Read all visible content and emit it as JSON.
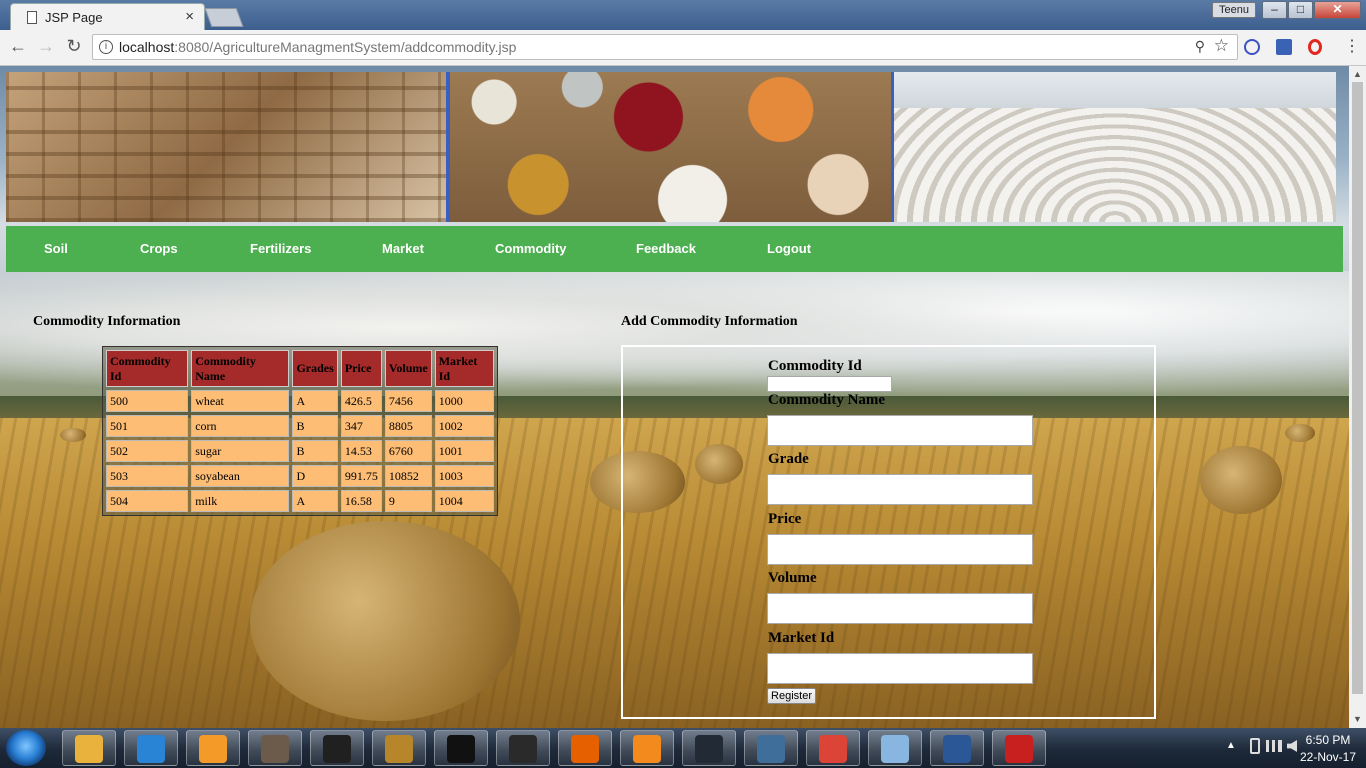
{
  "browser": {
    "tab_title": "JSP Page",
    "tab_close": "×",
    "user_badge": "Teenu",
    "win_min": "–",
    "win_max": "□",
    "win_close": "✕",
    "url_host": "localhost",
    "url_rest": ":8080/AgricultureManagmentSystem/addcommodity.jsp",
    "back": "←",
    "forward": "→",
    "reload": "↻",
    "info": "i",
    "zoom": "⚲",
    "star": "☆",
    "menu": "⋮"
  },
  "nav": {
    "items": [
      "Soil",
      "Crops",
      "Fertilizers",
      "Market",
      "Commodity",
      "Feedback",
      "Logout"
    ]
  },
  "list": {
    "title": "Commodity Information",
    "headers": [
      "Commodity Id",
      "Commodity Name",
      "Grades",
      "Price",
      "Volume",
      "Market Id"
    ],
    "rows": [
      [
        "500",
        "wheat",
        "A",
        "426.5",
        "7456",
        "1000"
      ],
      [
        "501",
        "corn",
        "B",
        "347",
        "8805",
        "1002"
      ],
      [
        "502",
        "sugar",
        "B",
        "14.53",
        "6760",
        "1001"
      ],
      [
        "503",
        "soyabean",
        "D",
        "991.75",
        "10852",
        "1003"
      ],
      [
        "504",
        "milk",
        "A",
        "16.58",
        "9",
        "1004"
      ]
    ]
  },
  "form": {
    "title": "Add Commodity Information",
    "commodity_id_label": "Commodity Id",
    "commodity_name_label": "Commodity Name",
    "grade_label": "Grade",
    "price_label": "Price",
    "volume_label": "Volume",
    "market_id_label": "Market Id",
    "register_label": "Register"
  },
  "taskbar": {
    "time": "6:50 PM",
    "date": "22-Nov-17",
    "tray_arrow": "▲",
    "apps": [
      {
        "icon": "file-explorer-icon",
        "color": "#e8b23c"
      },
      {
        "icon": "internet-explorer-icon",
        "color": "#2a84d6"
      },
      {
        "icon": "media-player-icon",
        "color": "#f39a28"
      },
      {
        "icon": "game-fifa-icon",
        "color": "#6c5a4a"
      },
      {
        "icon": "pes-15-icon",
        "color": "#202020"
      },
      {
        "icon": "counter-strike-icon",
        "color": "#b8862a"
      },
      {
        "icon": "wwe-icon",
        "color": "#111111"
      },
      {
        "icon": "sleeping-dogs-icon",
        "color": "#2a2a2a"
      },
      {
        "icon": "firefox-icon",
        "color": "#e66000"
      },
      {
        "icon": "sublime-text-icon",
        "color": "#f28a1d"
      },
      {
        "icon": "mysql-console-icon",
        "color": "#222a36"
      },
      {
        "icon": "mysql-workbench-icon",
        "color": "#3f6e9a"
      },
      {
        "icon": "chrome-icon",
        "color": "#db4437"
      },
      {
        "icon": "virtualbox-icon",
        "color": "#88b6e0"
      },
      {
        "icon": "word-icon",
        "color": "#2b5797"
      },
      {
        "icon": "acrobat-icon",
        "color": "#c8201e"
      }
    ]
  }
}
